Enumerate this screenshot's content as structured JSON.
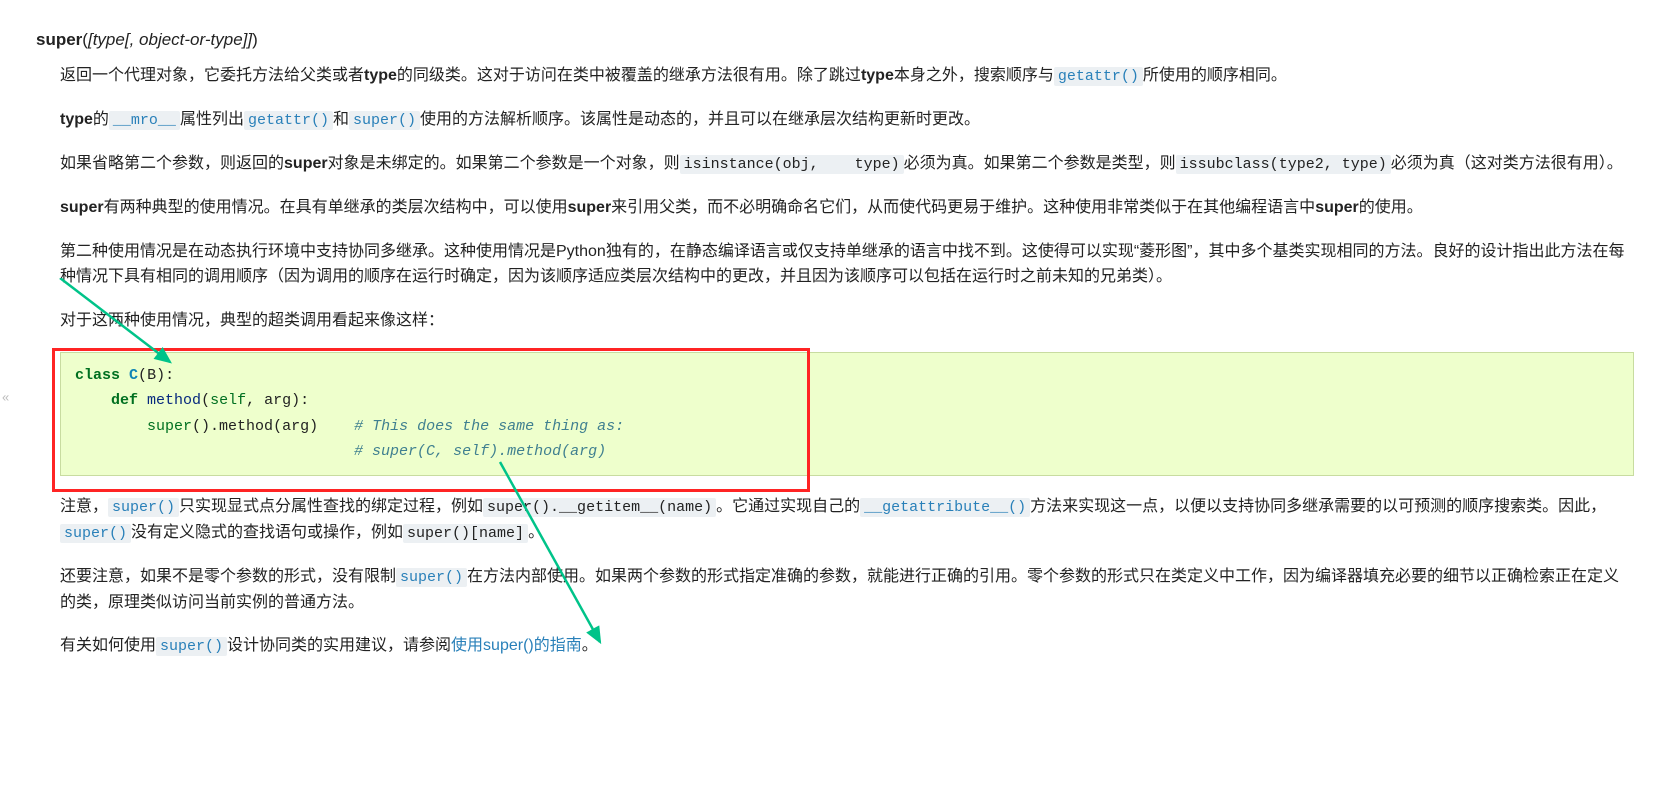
{
  "signature": {
    "name": "super",
    "args_html": "([<i>type</i>[, <i>object-or-type</i>]])"
  },
  "p1": {
    "t1": "返回一个代理对象，它委托方法给父类或者",
    "bold1": "type",
    "t2": "的同级类。这对于访问在类中被覆盖的继承方法很有用。除了跳过",
    "bold2": "type",
    "t3": "本身之外，搜索顺序与",
    "link1": "getattr()",
    "t4": "所使用的顺序相同。"
  },
  "p2": {
    "bold1": "type",
    "t1": "的",
    "link1": "__mro__",
    "t2": "属性列出",
    "link2": "getattr()",
    "t3": "和",
    "link3": "super()",
    "t4": "使用的方法解析顺序。该属性是动态的，并且可以在继承层次结构更新时更改。"
  },
  "p3": {
    "t1": "如果省略第二个参数，则返回的",
    "bold1": "super",
    "t2": "对象是未绑定的。如果第二个参数是一个对象，则",
    "code1": "isinstance(obj,    type)",
    "t3": "必须为真。如果第二个参数是类型，则",
    "code2": "issubclass(type2, type)",
    "t4": "必须为真（这对类方法很有用）。"
  },
  "p4": {
    "bold1": "super",
    "t1": "有两种典型的使用情况。在具有单继承的类层次结构中，可以使用",
    "bold2": "super",
    "t2": "来引用父类，而不必明确命名它们，从而使代码更易于维护。这种使用非常类似于在其他编程语言中",
    "bold3": "super",
    "t3": "的使用。"
  },
  "p5": "第二种使用情况是在动态执行环境中支持协同多继承。这种使用情况是Python独有的，在静态编译语言或仅支持单继承的语言中找不到。这使得可以实现“菱形图”，其中多个基类实现相同的方法。良好的设计指出此方法在每种情况下具有相同的调用顺序（因为调用的顺序在运行时确定，因为该顺序适应类层次结构中的更改，并且因为该顺序可以包括在运行时之前未知的兄弟类）。",
  "p6": "对于这两种使用情况，典型的超类调用看起来像这样：",
  "code_block": {
    "kw_class": "class",
    "class_name": "C",
    "base": "B",
    "kw_def": "def",
    "func_name": "method",
    "self_kw": "self",
    "arg": "arg",
    "builtin_super": "super",
    "method_call": "method",
    "arg2": "arg",
    "comment1": "# This does the same thing as:",
    "comment2": "# super(C, self).method(arg)"
  },
  "p7": {
    "t1": "注意，",
    "link1": "super()",
    "t2": "只实现显式点分属性查找的绑定过程，例如",
    "code1": "super().__getitem__(name)",
    "t3": "。它通过实现自己的",
    "link2": "__getattribute__()",
    "t4": "方法来实现这一点，以便以支持协同多继承需要的以可预测的顺序搜索类。因此，",
    "link3": "super()",
    "t5": "没有定义隐式的查找语句或操作，例如",
    "code2": "super()[name]",
    "t6": "。"
  },
  "p8": {
    "t1": "还要注意，如果不是零个参数的形式，没有限制",
    "link1": "super()",
    "t2": "在方法内部使用。如果两个参数的形式指定准确的参数，就能进行正确的引用。零个参数的形式只在类定义中工作，因为编译器填充必要的细节以正确检索正在定义的类，原理类似访问当前实例的普通方法。"
  },
  "p9": {
    "t1": "有关如何使用",
    "link1": "super()",
    "t2": "设计协同类的实用建议，请参阅",
    "link2": "使用super()的指南",
    "t3": "。"
  },
  "handle": "«"
}
